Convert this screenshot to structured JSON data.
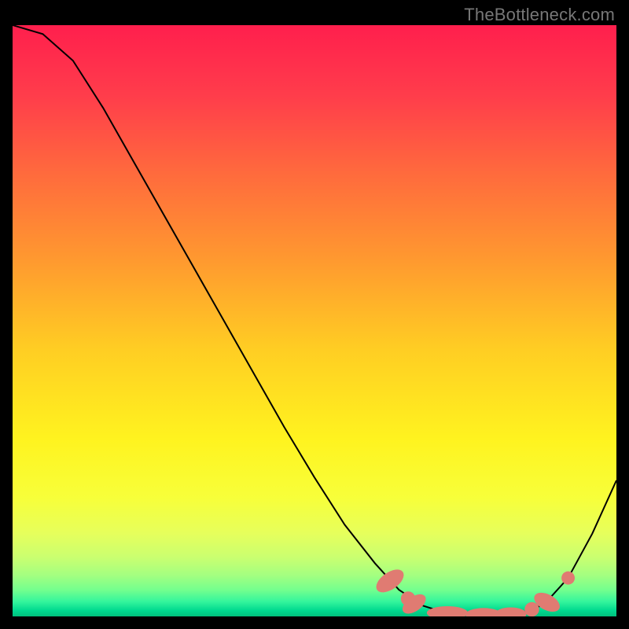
{
  "watermark": "TheBottleneck.com",
  "chart_data": {
    "type": "line",
    "title": "",
    "xlabel": "",
    "ylabel": "",
    "xlim": [
      0,
      100
    ],
    "ylim": [
      0,
      100
    ],
    "grid": false,
    "legend": false,
    "background_gradient": {
      "stops": [
        {
          "offset": 0.0,
          "color": "#ff1f4d"
        },
        {
          "offset": 0.12,
          "color": "#ff3d4b"
        },
        {
          "offset": 0.25,
          "color": "#ff6a3d"
        },
        {
          "offset": 0.4,
          "color": "#ff9a2f"
        },
        {
          "offset": 0.55,
          "color": "#ffce23"
        },
        {
          "offset": 0.7,
          "color": "#fff31f"
        },
        {
          "offset": 0.8,
          "color": "#f7ff3a"
        },
        {
          "offset": 0.86,
          "color": "#e6ff5c"
        },
        {
          "offset": 0.9,
          "color": "#caff70"
        },
        {
          "offset": 0.93,
          "color": "#a4ff80"
        },
        {
          "offset": 0.955,
          "color": "#74ff8e"
        },
        {
          "offset": 0.975,
          "color": "#34f59c"
        },
        {
          "offset": 0.99,
          "color": "#00d98f"
        },
        {
          "offset": 1.0,
          "color": "#00c07c"
        }
      ]
    },
    "series": [
      {
        "name": "curve",
        "stroke": "#000000",
        "stroke_width": 2,
        "x": [
          0.0,
          5.0,
          10.0,
          15.0,
          20.0,
          25.0,
          30.0,
          35.0,
          40.0,
          45.0,
          50.0,
          55.0,
          60.0,
          64.0,
          68.0,
          72.0,
          76.0,
          80.0,
          84.0,
          88.0,
          92.0,
          96.0,
          100.0
        ],
        "y": [
          100.0,
          98.5,
          94.0,
          86.0,
          77.0,
          68.0,
          59.0,
          50.0,
          41.0,
          32.0,
          23.5,
          15.5,
          9.0,
          4.5,
          1.8,
          0.5,
          0.2,
          0.2,
          0.5,
          2.0,
          6.5,
          14.0,
          23.0
        ]
      },
      {
        "name": "markers",
        "type": "scatter",
        "color": "#e07b72",
        "points": [
          {
            "x": 62.5,
            "y": 6.0,
            "shape": "ellipse",
            "rx": 1.4,
            "ry": 2.6,
            "rot": 55
          },
          {
            "x": 65.5,
            "y": 3.0,
            "shape": "circle",
            "r": 1.2
          },
          {
            "x": 66.5,
            "y": 2.1,
            "shape": "ellipse",
            "rx": 1.2,
            "ry": 2.2,
            "rot": 55
          },
          {
            "x": 72.0,
            "y": 0.6,
            "shape": "ellipse",
            "rx": 3.4,
            "ry": 1.1,
            "rot": 0
          },
          {
            "x": 78.0,
            "y": 0.3,
            "shape": "ellipse",
            "rx": 3.0,
            "ry": 1.1,
            "rot": 0
          },
          {
            "x": 82.5,
            "y": 0.4,
            "shape": "ellipse",
            "rx": 2.6,
            "ry": 1.1,
            "rot": 0
          },
          {
            "x": 86.0,
            "y": 1.2,
            "shape": "circle",
            "r": 1.2
          },
          {
            "x": 88.5,
            "y": 2.4,
            "shape": "ellipse",
            "rx": 1.3,
            "ry": 2.3,
            "rot": -62
          },
          {
            "x": 92.0,
            "y": 6.5,
            "shape": "circle",
            "r": 1.1
          }
        ]
      }
    ]
  }
}
